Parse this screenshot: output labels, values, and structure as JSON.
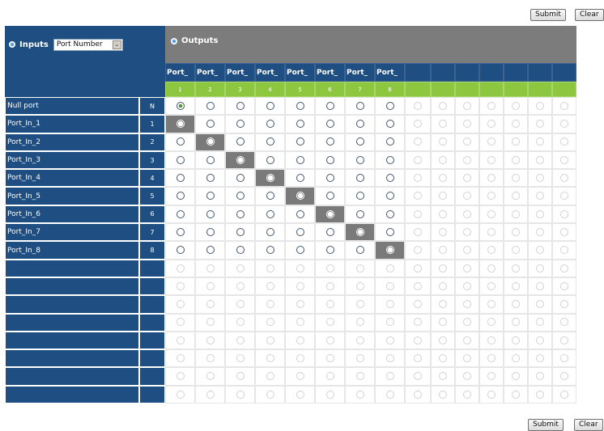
{
  "toolbar_top": {
    "submit_label": "Submit",
    "clear_label": "Clear"
  },
  "toolbar_bottom": {
    "submit_label": "Submit",
    "clear_label": "Clear"
  },
  "inputs_panel": {
    "label": "Inputs",
    "selector_value": "Port Number",
    "selector_arrow": "⌄"
  },
  "outputs_panel": {
    "label": "Outputs"
  },
  "outputs": [
    {
      "label": "Port_",
      "number": "1"
    },
    {
      "label": "Port_",
      "number": "2"
    },
    {
      "label": "Port_",
      "number": "3"
    },
    {
      "label": "Port_",
      "number": "4"
    },
    {
      "label": "Port_",
      "number": "5"
    },
    {
      "label": "Port_",
      "number": "6"
    },
    {
      "label": "Port_",
      "number": "7"
    },
    {
      "label": "Port_",
      "number": "8"
    }
  ],
  "empty_output_columns": 7,
  "inputs": [
    {
      "label": "Null port",
      "index": "N"
    },
    {
      "label": "Port_In_1",
      "index": "1"
    },
    {
      "label": "Port_In_2",
      "index": "2"
    },
    {
      "label": "Port_In_3",
      "index": "3"
    },
    {
      "label": "Port_In_4",
      "index": "4"
    },
    {
      "label": "Port_In_5",
      "index": "5"
    },
    {
      "label": "Port_In_6",
      "index": "6"
    },
    {
      "label": "Port_In_7",
      "index": "7"
    },
    {
      "label": "Port_In_8",
      "index": "8"
    }
  ],
  "empty_input_rows": 8,
  "routing": {
    "null_port_output_selected": 1,
    "highlighted_pairs": [
      [
        1,
        1
      ],
      [
        2,
        2
      ],
      [
        3,
        3
      ],
      [
        4,
        4
      ],
      [
        5,
        5
      ],
      [
        6,
        6
      ],
      [
        7,
        7
      ],
      [
        8,
        8
      ]
    ]
  },
  "colors": {
    "input_panel": "#1e4e82",
    "output_header": "#7c7c7c",
    "output_number_bar": "#8dc63f",
    "selected_cell": "#7a7a7a"
  }
}
